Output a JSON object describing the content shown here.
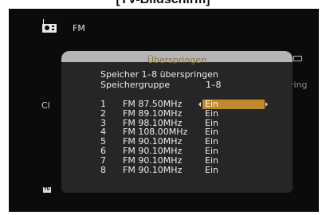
{
  "caption": "[TV-Bildschirm]",
  "source": "FM",
  "background_fragments": {
    "left": "Cl",
    "right": "ying"
  },
  "dialog": {
    "title": "Überspringen",
    "memory_skip_label": "Speicher 1–8 überspringen",
    "group_label": "Speichergruppe",
    "group_value": "1–8",
    "presets": [
      {
        "number": "1",
        "frequency": "FM 87.50MHz",
        "setting": "Ein",
        "selected": true
      },
      {
        "number": "2",
        "frequency": "FM 89.10MHz",
        "setting": "Ein",
        "selected": false
      },
      {
        "number": "3",
        "frequency": "FM 98.10MHz",
        "setting": "Ein",
        "selected": false
      },
      {
        "number": "4",
        "frequency": "FM 108.00MHz",
        "setting": "Ein",
        "selected": false
      },
      {
        "number": "5",
        "frequency": "FM 90.10MHz",
        "setting": "Ein",
        "selected": false
      },
      {
        "number": "6",
        "frequency": "FM 90.10MHz",
        "setting": "Ein",
        "selected": false
      },
      {
        "number": "7",
        "frequency": "FM 90.10MHz",
        "setting": "Ein",
        "selected": false
      },
      {
        "number": "8",
        "frequency": "FM 90.10MHz",
        "setting": "Ein",
        "selected": false
      }
    ]
  },
  "icons": {
    "source": "radio-icon",
    "tuner": "tuner-badge",
    "prev": "arrow-left-icon",
    "next": "arrow-right-icon"
  },
  "colors": {
    "highlight": "#c08a2c",
    "title_text": "#8f6e39",
    "header_bg": "#b5b5b5",
    "dialog_bg": "#262626",
    "screen_bg": "#0b0b0b"
  }
}
